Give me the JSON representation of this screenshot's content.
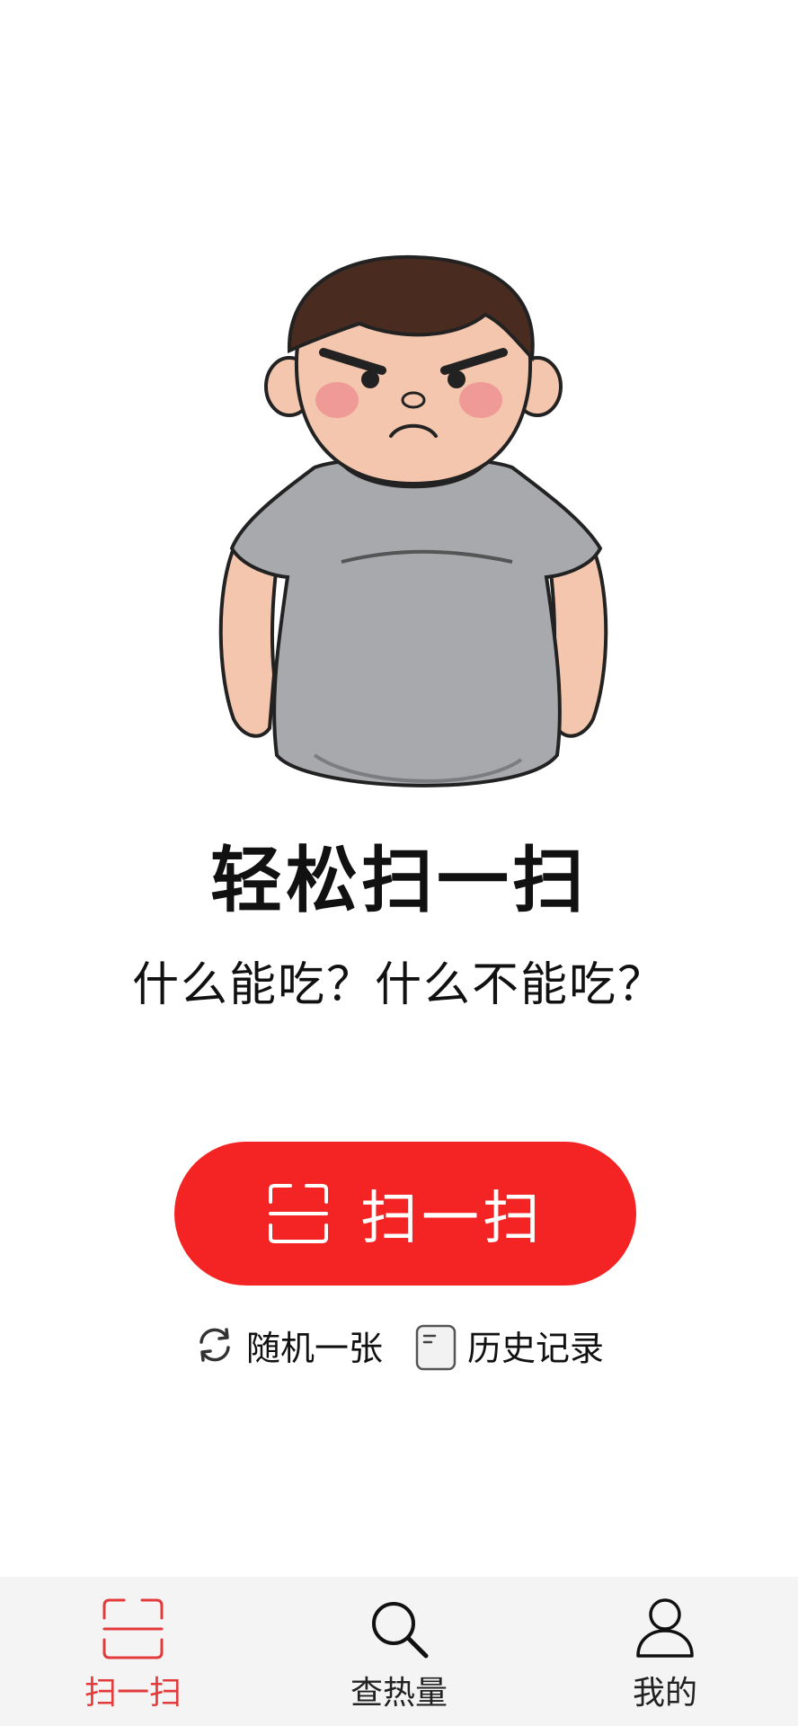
{
  "hero": {
    "illustration": "angry-chubby-boy-illustration",
    "title": "轻松扫一扫",
    "subtitle": "什么能吃？什么不能吃？"
  },
  "scan_button": {
    "label": "扫一扫",
    "icon": "scan-frame-icon",
    "color": "#f42424"
  },
  "secondary_actions": [
    {
      "label": "随机一张",
      "icon": "refresh-icon"
    },
    {
      "label": "历史记录",
      "icon": "history-document-icon"
    }
  ],
  "tab_bar": {
    "active_color": "#e33b3b",
    "tabs": [
      {
        "label": "扫一扫",
        "icon": "scan-frame-icon",
        "active": true
      },
      {
        "label": "查热量",
        "icon": "search-icon",
        "active": false
      },
      {
        "label": "我的",
        "icon": "person-icon",
        "active": false
      }
    ]
  }
}
